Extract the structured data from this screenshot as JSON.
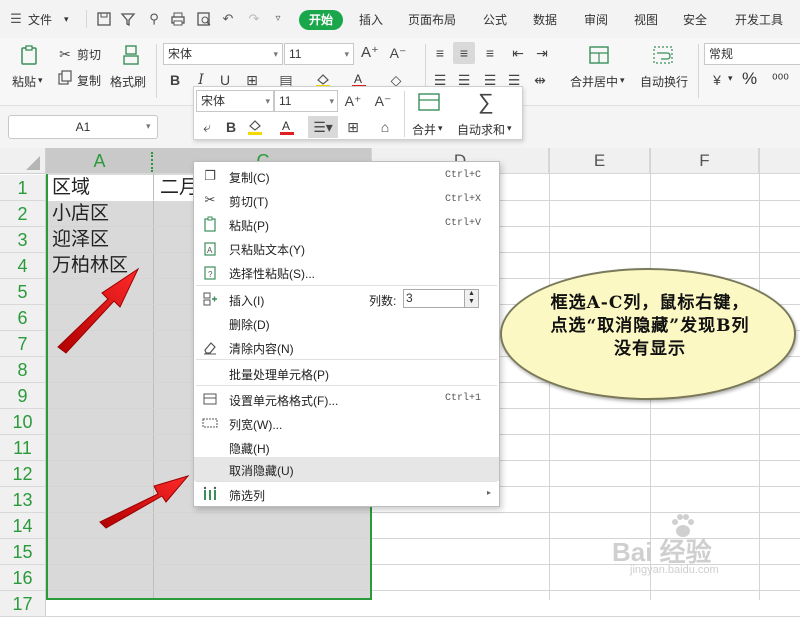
{
  "menubar": {
    "file_menu": "文件",
    "tabs": [
      "开始",
      "插入",
      "页面布局",
      "公式",
      "数据",
      "审阅",
      "视图",
      "安全",
      "开发工具"
    ],
    "active_tab": "开始"
  },
  "ribbon": {
    "paste_label": "粘贴",
    "cut_label": "剪切",
    "copy_label": "复制",
    "format_painter_label": "格式刷",
    "font_name": "宋体",
    "font_size": "11",
    "merge_center_label": "合并居中",
    "wrap_text_label": "自动换行",
    "number_format": "常规",
    "percent_symbol": "%"
  },
  "mini_toolbar": {
    "font_name": "宋体",
    "font_size": "11",
    "merge_label": "合并",
    "autosum_label": "自动求和"
  },
  "name_box": "A1",
  "columns": [
    "A",
    "B",
    "C",
    "D",
    "E",
    "F"
  ],
  "rows": [
    "1",
    "2",
    "3",
    "4",
    "5",
    "6",
    "7",
    "8",
    "9",
    "10",
    "11",
    "12",
    "13",
    "14",
    "15",
    "16",
    "17"
  ],
  "cells": {
    "A1": "区域",
    "A2": "小店区",
    "A3": "迎泽区",
    "A4": "万柏林区",
    "B1_partial": "二月"
  },
  "context_menu": {
    "items": [
      {
        "label": "复制(C)",
        "shortcut": "Ctrl+C",
        "icon": "copy-icon"
      },
      {
        "label": "剪切(T)",
        "shortcut": "Ctrl+X",
        "icon": "scissors-icon"
      },
      {
        "label": "粘贴(P)",
        "shortcut": "Ctrl+V",
        "icon": "paste-icon"
      },
      {
        "label": "只粘贴文本(Y)",
        "shortcut": "",
        "icon": "paste-text-icon"
      },
      {
        "label": "选择性粘贴(S)...",
        "shortcut": "",
        "icon": "paste-special-icon"
      },
      {
        "label": "插入(I)",
        "shortcut": "",
        "icon": "insert-icon"
      },
      {
        "label": "删除(D)",
        "shortcut": "",
        "icon": ""
      },
      {
        "label": "清除内容(N)",
        "shortcut": "",
        "icon": "eraser-icon"
      },
      {
        "label": "批量处理单元格(P)",
        "shortcut": "",
        "icon": ""
      },
      {
        "label": "设置单元格格式(F)...",
        "shortcut": "Ctrl+1",
        "icon": "format-cells-icon"
      },
      {
        "label": "列宽(W)...",
        "shortcut": "",
        "icon": "column-width-icon"
      },
      {
        "label": "隐藏(H)",
        "shortcut": "",
        "icon": ""
      },
      {
        "label": "取消隐藏(U)",
        "shortcut": "",
        "icon": ""
      },
      {
        "label": "筛选列",
        "shortcut": "",
        "icon": "filter-columns-icon"
      }
    ],
    "insert_count_label": "列数:",
    "insert_count_value": "3"
  },
  "callout": {
    "text": "框选A-C列，鼠标右键，点选“取消隐藏”发现B列没有显示"
  },
  "watermark": {
    "brand": "Bai 经验",
    "url": "jingyan.baidu.com"
  },
  "colors": {
    "accent_green": "#1aa64b",
    "selection_border": "#2b9a3b",
    "arrow_red": "#e01010",
    "callout_fill": "#fbf8c4"
  }
}
